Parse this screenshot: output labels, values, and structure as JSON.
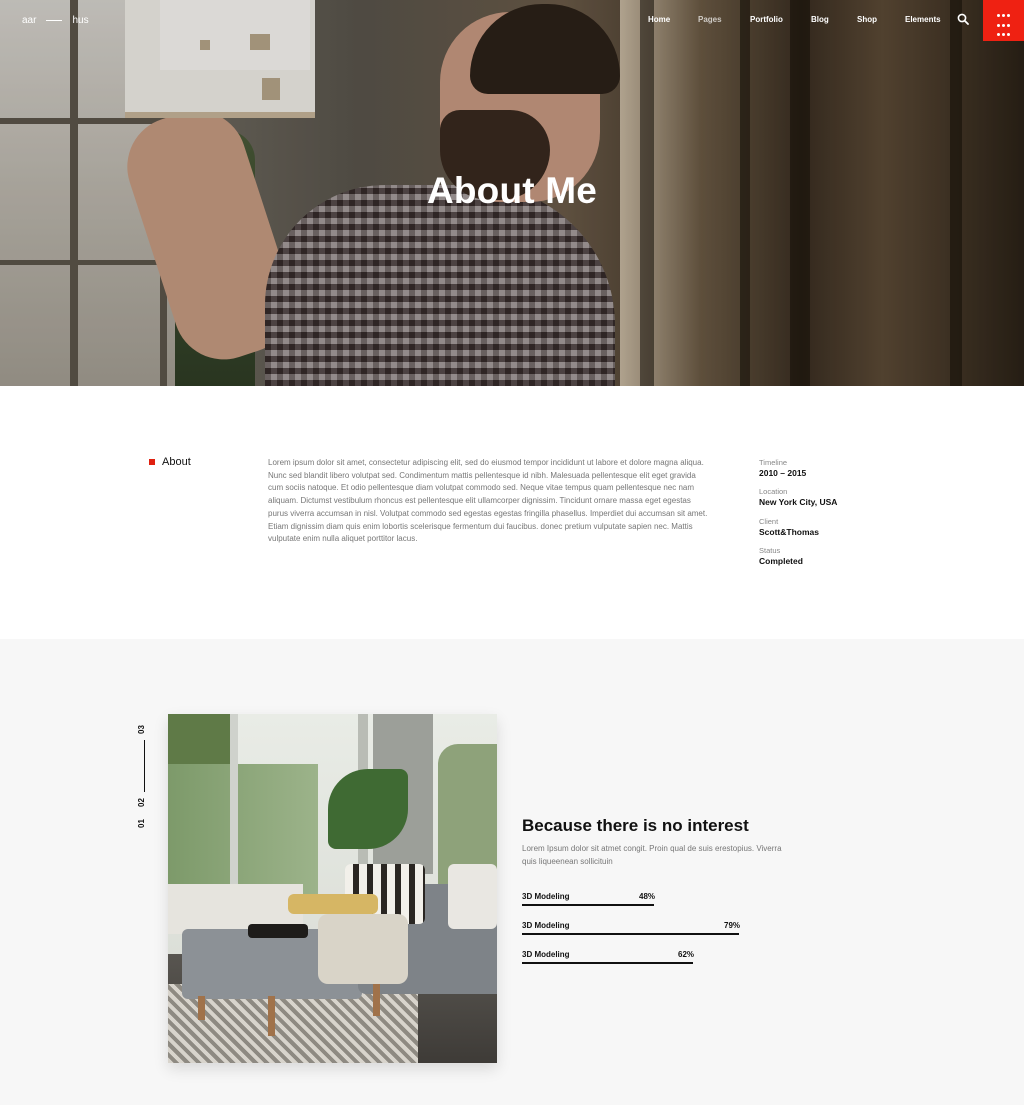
{
  "header": {
    "logo_left": "aar",
    "logo_right": "hus",
    "nav": [
      "Home",
      "Pages",
      "Portfolio",
      "Blog",
      "Shop",
      "Elements"
    ],
    "active_nav": "Pages",
    "search_icon": "search-icon",
    "menu_icon": "grid-dots-icon",
    "accent_color": "#ef2112"
  },
  "hero": {
    "title": "About Me"
  },
  "about": {
    "label": "About",
    "text": "Lorem ipsum dolor sit amet, consectetur adipiscing elit, sed do eiusmod tempor incididunt ut labore et dolore magna aliqua. Nunc sed blandit libero volutpat sed. Condimentum mattis pellentesque id nibh. Malesuada pellentesque elit eget gravida cum sociis natoque. Et odio pellentesque diam volutpat commodo sed. Neque vitae tempus quam pellentesque nec nam aliquam. Dictumst vestibulum rhoncus est pellentesque elit ullamcorper dignissim. Tincidunt ornare massa eget egestas purus viverra accumsan in nisl. Volutpat commodo sed egestas egestas fringilla phasellus. Imperdiet dui accumsan sit amet. Etiam dignissim diam quis enim lobortis scelerisque fermentum dui faucibus. donec pretium vulputate sapien nec. Mattis vulputate enim nulla aliquet porttitor lacus.",
    "meta": [
      {
        "key": "Timeline",
        "value": "2010 – 2015"
      },
      {
        "key": "Location",
        "value": "New York City, USA"
      },
      {
        "key": "Client",
        "value": "Scott&Thomas"
      },
      {
        "key": "Status",
        "value": "Completed"
      }
    ]
  },
  "project": {
    "slider_numbers": [
      "01",
      "02",
      "03"
    ],
    "title": "Because there is no interest",
    "description": "Lorem Ipsum dolor sit atmet congit. Proin qual de suis erestopius. Viverra quis  liqueenean sollicituin",
    "skills": [
      {
        "label": "3D Modeling",
        "percent": 48,
        "percent_text": "48%"
      },
      {
        "label": "3D Modeling",
        "percent": 79,
        "percent_text": "79%"
      },
      {
        "label": "3D Modeling",
        "percent": 62,
        "percent_text": "62%"
      }
    ]
  }
}
